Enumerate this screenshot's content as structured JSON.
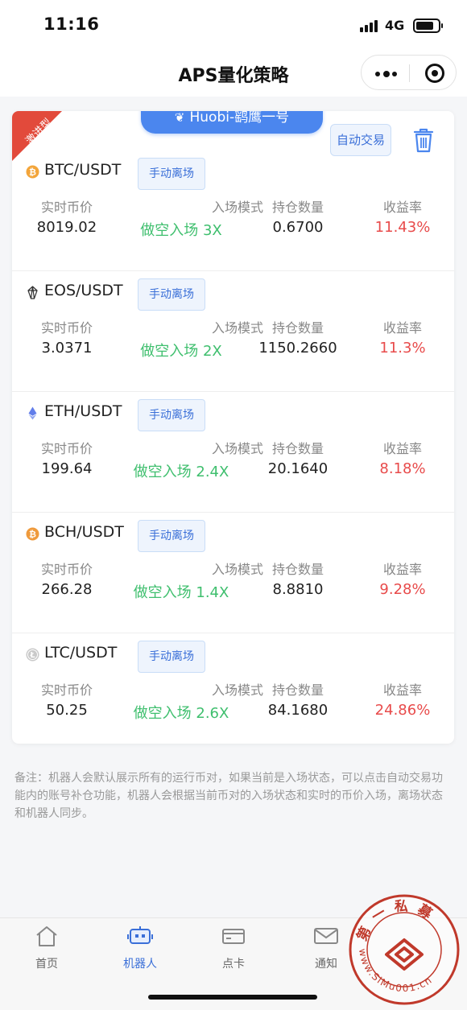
{
  "status_bar": {
    "time": "11:16",
    "network": "4G"
  },
  "nav": {
    "title": "APS量化策略"
  },
  "card": {
    "corner_badge": "激进型",
    "account_name": "Huobi-鹞鹰一号",
    "auto_trade_label": "自动交易",
    "column_labels": {
      "price": "实时币价",
      "mode": "入场模式",
      "qty": "持仓数量",
      "yield": "收益率"
    },
    "exit_label": "手动离场",
    "pairs": [
      {
        "name": "BTC/USDT",
        "icon": "bitcoin-icon",
        "price": "8019.02",
        "mode": "做空入场 3X",
        "qty": "0.6700",
        "yield": "11.43%"
      },
      {
        "name": "EOS/USDT",
        "icon": "eos-icon",
        "price": "3.0371",
        "mode": "做空入场 2X",
        "qty": "1150.2660",
        "yield": "11.3%"
      },
      {
        "name": "ETH/USDT",
        "icon": "ethereum-icon",
        "price": "199.64",
        "mode": "做空入场 2.4X",
        "qty": "20.1640",
        "yield": "8.18%"
      },
      {
        "name": "BCH/USDT",
        "icon": "bitcoin-cash-icon",
        "price": "266.28",
        "mode": "做空入场 1.4X",
        "qty": "8.8810",
        "yield": "9.28%"
      },
      {
        "name": "LTC/USDT",
        "icon": "litecoin-icon",
        "price": "50.25",
        "mode": "做空入场 2.6X",
        "qty": "84.1680",
        "yield": "24.86%"
      }
    ]
  },
  "note": "备注：机器人会默认展示所有的运行币对，如果当前是入场状态，可以点击自动交易功能内的账号补仓功能，机器人会根据当前币对的入场状态和实时的币价入场，离场状态和机器人同步。",
  "tab_bar": {
    "items": [
      {
        "label": "首页",
        "icon": "home-icon",
        "active": false
      },
      {
        "label": "机器人",
        "icon": "robot-icon",
        "active": true
      },
      {
        "label": "点卡",
        "icon": "card-icon",
        "active": false
      },
      {
        "label": "通知",
        "icon": "mail-icon",
        "active": false
      }
    ]
  },
  "watermark": {
    "top_text": "第一私募",
    "url": "www.SiMu001.cn"
  },
  "colors": {
    "accent": "#4b86ee",
    "green": "#3fbf6e",
    "red": "#e84b4b",
    "badge": "#e24a3b"
  }
}
